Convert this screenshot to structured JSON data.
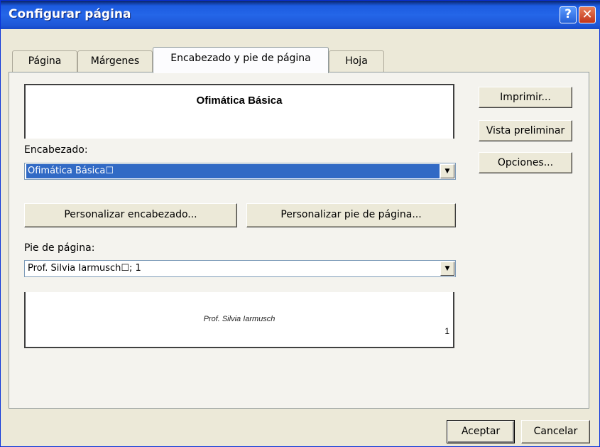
{
  "window": {
    "title": "Configurar página",
    "help_glyph": "?",
    "close_glyph": "✕"
  },
  "tabs": [
    {
      "label": "Página"
    },
    {
      "label": "Márgenes"
    },
    {
      "label": "Encabezado y pie de página",
      "active": true
    },
    {
      "label": "Hoja"
    }
  ],
  "header_preview": {
    "text": "Ofimática Básica"
  },
  "encabezado": {
    "label": "Encabezado:",
    "value": "Ofimática Básica☐"
  },
  "buttons": {
    "customize_header": "Personalizar encabezado...",
    "customize_footer": "Personalizar pie de página...",
    "print": "Imprimir...",
    "preview": "Vista preliminar",
    "options": "Opciones...",
    "accept": "Aceptar",
    "cancel": "Cancelar"
  },
  "pie": {
    "label": "Pie de página:",
    "value": "Prof. Silvia Iarmusch☐; 1"
  },
  "footer_preview": {
    "text": "Prof. Silvia Iarmusch",
    "page_number": "1"
  },
  "colors": {
    "title_bar": "#2466E8",
    "selection": "#316AC5",
    "dialog_bg": "#ECE9D8"
  },
  "icons": {
    "help": "help-icon",
    "close": "close-icon",
    "dropdown": "chevron-down-icon"
  }
}
